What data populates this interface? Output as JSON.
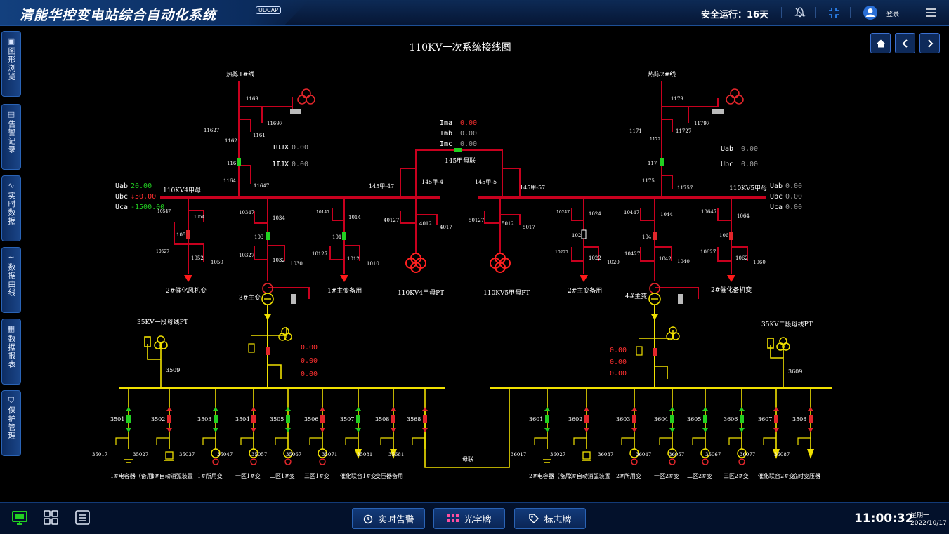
{
  "header": {
    "app_title": "清能华控变电站综合自动化系统",
    "badge": "UDCAP",
    "safe_days": "安全运行：16天",
    "login": "登录"
  },
  "sidebar": {
    "items": [
      {
        "label": "图形浏览",
        "icon": "diagram-icon"
      },
      {
        "label": "告警记录",
        "icon": "alarm-record-icon"
      },
      {
        "label": "实时数据",
        "icon": "realtime-data-icon"
      },
      {
        "label": "数据曲线",
        "icon": "curve-icon"
      },
      {
        "label": "数据报表",
        "icon": "report-icon"
      },
      {
        "label": "保护管理",
        "icon": "shield-icon"
      }
    ]
  },
  "diagram": {
    "title": "110KV一次系统接线图",
    "labels": {
      "line1": "热陈1#线",
      "line2": "热陈2#线",
      "bus4": "110KV4甲母",
      "bus5": "110KV5甲母",
      "bus_tie": "145甲母联",
      "pt4": "110KV4甲母PT",
      "pt5": "110KV5甲母PT",
      "feeder_105": "2#催化风机变",
      "feeder_101": "1#主变备用",
      "feeder_102": "2#主变备用",
      "feeder_106": "2#催化备机变",
      "mt3": "3#主变",
      "mt4": "4#主变",
      "pt35_1": "35KV一段母线PT",
      "pt35_2": "35KV二段母线PT",
      "bus_link": "母联"
    },
    "ids": {
      "n1169": "1169",
      "n11697": "11697",
      "n11627": "11627",
      "n1162": "1162",
      "n1161": "1161",
      "n116": "116",
      "n1164": "1164",
      "n11647": "11647",
      "n1179": "1179",
      "n11797": "11797",
      "n1171": "1171",
      "n1172": "1172",
      "n11727": "11727",
      "n117": "117",
      "n1175": "1175",
      "n11757": "11757",
      "n14547": "145甲-47",
      "n1454": "145甲-4",
      "n1455": "145甲-5",
      "n14557": "145甲-57",
      "n40127": "40127",
      "n4012": "4012",
      "n4017": "4017",
      "n50127": "50127",
      "n5012": "5012",
      "n5017": "5017",
      "n10547": "10547",
      "n1054": "1054",
      "n105": "105",
      "n10527": "10527",
      "n1052": "1052",
      "n1050": "1050",
      "n10347": "10347",
      "n1034": "1034",
      "n103": "103",
      "n10327": "10327",
      "n1032": "1032",
      "n1030": "1030",
      "n10147": "10147",
      "n1014": "1014",
      "n101": "101",
      "n10127": "10127",
      "n1012": "1012",
      "n1010": "1010",
      "n10247": "10247",
      "n1024": "1024",
      "n102": "102",
      "n10227": "10227",
      "n1022": "1022",
      "n1020": "1020",
      "n10447": "10447",
      "n1044": "1044",
      "n104": "104",
      "n10427": "10427",
      "n1042": "1042",
      "n1040": "1040",
      "n10647": "10647",
      "n1064": "1064",
      "n106": "106",
      "n10627": "10627",
      "n1062": "1062",
      "n1060": "1060",
      "n3509": "3509",
      "n3609": "3609"
    },
    "meas": {
      "Ima": {
        "label": "Ima",
        "value": "0.00"
      },
      "Imb": {
        "label": "Imb",
        "value": "0.00"
      },
      "Imc": {
        "label": "Imc",
        "value": "0.00"
      },
      "UJX1": {
        "label": "1UJX",
        "value": "0.00"
      },
      "IJX1": {
        "label": "1IJX",
        "value": "0.00"
      },
      "Uab2": {
        "label": "Uab",
        "value": "0.00"
      },
      "Ubc2": {
        "label": "Ubc",
        "value": "0.00"
      },
      "bus4_Uab": {
        "label": "Uab",
        "value": "20.00"
      },
      "bus4_Ubc": {
        "label": "Ubc",
        "value": "↓50.00"
      },
      "bus4_Uca": {
        "label": "Uca",
        "value": "-1500.00"
      },
      "bus5_Uab": {
        "label": "Uab",
        "value": "0.00"
      },
      "bus5_Ubc": {
        "label": "Ubc",
        "value": "0.00"
      },
      "bus5_Uca": {
        "label": "Uca",
        "value": "0.00"
      },
      "mt3_vals": [
        "0.00",
        "0.00",
        "0.00"
      ],
      "mt4_vals": [
        "0.00",
        "0.00",
        "0.00"
      ]
    },
    "feeders_left": [
      {
        "id": "3501",
        "ground": "35017",
        "label": "1#电容器（备用）",
        "color": "green"
      },
      {
        "id": "3502",
        "ground": "35027",
        "label": "1#自动消弧装置",
        "color": "red"
      },
      {
        "id": "3503",
        "ground": "35037",
        "label": "1#所用变",
        "color": "green"
      },
      {
        "id": "3504",
        "ground": "35047",
        "label": "一区1#变",
        "color": "red"
      },
      {
        "id": "3505",
        "ground": "35057",
        "label": "二区1#变",
        "color": "green"
      },
      {
        "id": "3506",
        "ground": "35067",
        "label": "三区1#变",
        "color": "red"
      },
      {
        "id": "3507",
        "ground": "35071",
        "label": "催化联合1#变",
        "color": "green"
      },
      {
        "id": "3508",
        "ground": "35081",
        "label": "变压器备用",
        "color": "red"
      },
      {
        "id": "3568",
        "ground": "35681",
        "label": "",
        "color": "red"
      }
    ],
    "feeders_right": [
      {
        "id": "3601",
        "ground": "36017",
        "label": "2#电容器（备用）",
        "color": "green"
      },
      {
        "id": "3602",
        "ground": "36027",
        "label": "2#自动消弧装置",
        "color": "red"
      },
      {
        "id": "3603",
        "ground": "36037",
        "label": "2#所用变",
        "color": "red"
      },
      {
        "id": "3604",
        "ground": "36047",
        "label": "一区2#变",
        "color": "green"
      },
      {
        "id": "3605",
        "ground": "36057",
        "label": "二区2#变",
        "color": "green"
      },
      {
        "id": "3606",
        "ground": "36067",
        "label": "三区2#变",
        "color": "green"
      },
      {
        "id": "3607",
        "ground": "36077",
        "label": "催化联合2#变",
        "color": "red"
      },
      {
        "id": "3508",
        "ground": "35087",
        "label": "临时变压器",
        "color": "red"
      }
    ]
  },
  "bottombar": {
    "btn_alarm": "实时告警",
    "btn_light": "光字牌",
    "btn_tag": "标志牌",
    "time": "11:00:32",
    "weekday": "星期一",
    "date": "2022/10/17"
  },
  "colors": {
    "bus110": "#c8001e",
    "bus35": "#f0e000",
    "closed": "#e3262b",
    "open": "#22d022",
    "line": "#c8001e"
  }
}
